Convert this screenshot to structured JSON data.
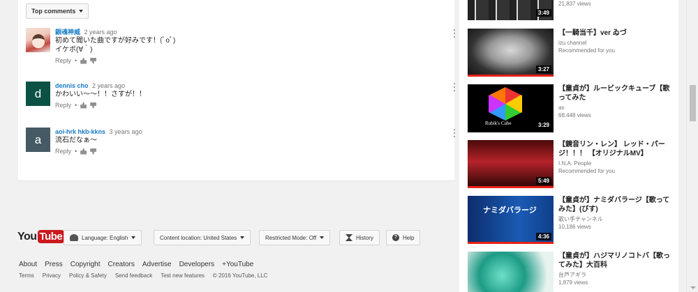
{
  "comments": {
    "sort_label": "Top comments",
    "items": [
      {
        "author": "銀魂神威",
        "time": "2 years ago",
        "lines": [
          "初めて聞いた曲ですが好みです！(ﾟoﾟ)",
          "イケボ(∀｀)"
        ],
        "reply": "Reply",
        "avatar_letter": "",
        "avatar_color": ""
      },
      {
        "author": "dennis cho",
        "time": "2 years ago",
        "lines": [
          "かわいい〜〜！！さすが！！"
        ],
        "reply": "Reply",
        "avatar_letter": "d",
        "avatar_color": "#0b5244"
      },
      {
        "author": "aoi-hrk hkb-kkns",
        "time": "3 years ago",
        "lines": [
          "流石だなぁ〜"
        ],
        "reply": "Reply",
        "avatar_letter": "a",
        "avatar_color": "#455a64"
      }
    ]
  },
  "footer": {
    "logo_you": "You",
    "logo_tube": "Tube",
    "buttons": {
      "language": "Language: English",
      "location": "Content location: United States",
      "restricted": "Restricted Mode: Off",
      "history": "History",
      "help": "Help"
    },
    "links_primary": [
      "About",
      "Press",
      "Copyright",
      "Creators",
      "Advertise",
      "Developers",
      "+YouTube"
    ],
    "links_secondary": [
      "Terms",
      "Privacy",
      "Policy & Safety",
      "Send feedback",
      "Test new features",
      "© 2016 YouTube, LLC"
    ]
  },
  "sidebar": {
    "videos": [
      {
        "title": "",
        "meta1": "21,837 views",
        "meta2": "",
        "duration": "3:49"
      },
      {
        "title": "【一騎当千】ver ゐづ",
        "meta1": "izu channel",
        "meta2": "Recommended for you",
        "duration": "3:27"
      },
      {
        "title": "【童貞が】ルービックキューブ【歌ってみた",
        "meta1": "as",
        "meta2": "68,448 views",
        "duration": "3:29",
        "thumb_text": "Rubik's Cube"
      },
      {
        "title": "【鏡音リン・レン】 レッド・パージ！！！ 【オリジナルMV】",
        "meta1": "I.N.A. People",
        "meta2": "Recommended for you",
        "duration": "5:49"
      },
      {
        "title": "【童貞が】ナミダバラージ【歌ってみた】(びす)",
        "meta1": "歌い手チャンネル",
        "meta2": "10,186 views",
        "duration": "4:36",
        "thumb_text": "ナミダバラージ"
      },
      {
        "title": "【童貞が】ハジマリノコトバ【歌ってみた】大百科",
        "meta1": "台芦アギラ",
        "meta2": "1,879 views",
        "duration": ""
      }
    ]
  }
}
